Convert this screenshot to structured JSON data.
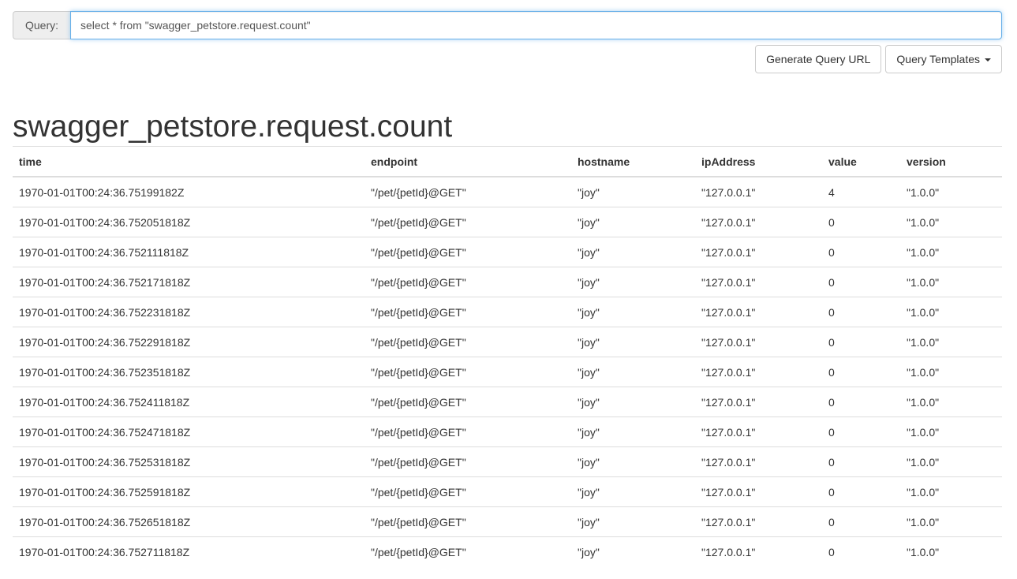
{
  "query": {
    "label": "Query:",
    "value": "select * from \"swagger_petstore.request.count\""
  },
  "buttons": {
    "generate_url": "Generate Query URL",
    "templates": "Query Templates"
  },
  "result": {
    "title": "swagger_petstore.request.count",
    "columns": [
      "time",
      "endpoint",
      "hostname",
      "ipAddress",
      "value",
      "version"
    ],
    "rows": [
      [
        "1970-01-01T00:24:36.75199182Z",
        "\"/pet/{petId}@GET\"",
        "\"joy\"",
        "\"127.0.0.1\"",
        "4",
        "\"1.0.0\""
      ],
      [
        "1970-01-01T00:24:36.752051818Z",
        "\"/pet/{petId}@GET\"",
        "\"joy\"",
        "\"127.0.0.1\"",
        "0",
        "\"1.0.0\""
      ],
      [
        "1970-01-01T00:24:36.752111818Z",
        "\"/pet/{petId}@GET\"",
        "\"joy\"",
        "\"127.0.0.1\"",
        "0",
        "\"1.0.0\""
      ],
      [
        "1970-01-01T00:24:36.752171818Z",
        "\"/pet/{petId}@GET\"",
        "\"joy\"",
        "\"127.0.0.1\"",
        "0",
        "\"1.0.0\""
      ],
      [
        "1970-01-01T00:24:36.752231818Z",
        "\"/pet/{petId}@GET\"",
        "\"joy\"",
        "\"127.0.0.1\"",
        "0",
        "\"1.0.0\""
      ],
      [
        "1970-01-01T00:24:36.752291818Z",
        "\"/pet/{petId}@GET\"",
        "\"joy\"",
        "\"127.0.0.1\"",
        "0",
        "\"1.0.0\""
      ],
      [
        "1970-01-01T00:24:36.752351818Z",
        "\"/pet/{petId}@GET\"",
        "\"joy\"",
        "\"127.0.0.1\"",
        "0",
        "\"1.0.0\""
      ],
      [
        "1970-01-01T00:24:36.752411818Z",
        "\"/pet/{petId}@GET\"",
        "\"joy\"",
        "\"127.0.0.1\"",
        "0",
        "\"1.0.0\""
      ],
      [
        "1970-01-01T00:24:36.752471818Z",
        "\"/pet/{petId}@GET\"",
        "\"joy\"",
        "\"127.0.0.1\"",
        "0",
        "\"1.0.0\""
      ],
      [
        "1970-01-01T00:24:36.752531818Z",
        "\"/pet/{petId}@GET\"",
        "\"joy\"",
        "\"127.0.0.1\"",
        "0",
        "\"1.0.0\""
      ],
      [
        "1970-01-01T00:24:36.752591818Z",
        "\"/pet/{petId}@GET\"",
        "\"joy\"",
        "\"127.0.0.1\"",
        "0",
        "\"1.0.0\""
      ],
      [
        "1970-01-01T00:24:36.752651818Z",
        "\"/pet/{petId}@GET\"",
        "\"joy\"",
        "\"127.0.0.1\"",
        "0",
        "\"1.0.0\""
      ],
      [
        "1970-01-01T00:24:36.752711818Z",
        "\"/pet/{petId}@GET\"",
        "\"joy\"",
        "\"127.0.0.1\"",
        "0",
        "\"1.0.0\""
      ]
    ]
  }
}
